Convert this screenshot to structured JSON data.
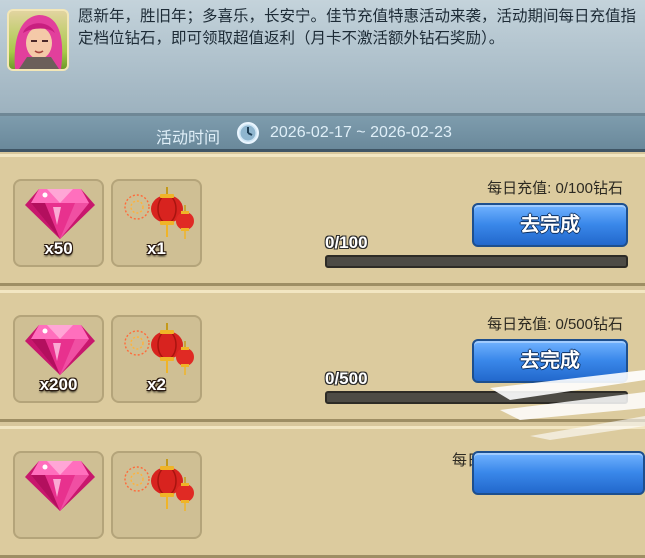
{
  "header": {
    "avatar_icon": "hero-avatar-icon",
    "intro_text": "愿新年，胜旧年；多喜乐，长安宁。佳节充值特惠活动来袭，活动期间每日充值指定档位钻石，即可领取超值返利（月卡不激活额外钻石奖励）。"
  },
  "event_time": {
    "label": "活动时间",
    "icon": "clock-icon",
    "range": "2026-02-17 ~ 2026-02-23"
  },
  "tasks": [
    {
      "requirement": "每日充值: 0/100钻石",
      "button_label": "去完成",
      "progress_text": "0/100",
      "progress_fraction": 0,
      "rewards": [
        {
          "icon": "pink-diamond-icon",
          "quantity": "x50"
        },
        {
          "icon": "firecracker-lantern-icon",
          "quantity": "x1"
        }
      ]
    },
    {
      "requirement": "每日充值: 0/500钻石",
      "button_label": "去完成",
      "progress_text": "0/500",
      "progress_fraction": 0,
      "rewards": [
        {
          "icon": "pink-diamond-icon",
          "quantity": "x200"
        },
        {
          "icon": "firecracker-lantern-icon",
          "quantity": "x2"
        }
      ]
    },
    {
      "requirement": "每日",
      "rewards": [
        {
          "icon": "pink-diamond-icon"
        },
        {
          "icon": "firecracker-lantern-icon"
        }
      ]
    }
  ],
  "colors": {
    "header_bg": "#b3c6d1",
    "timebar_bg": "#7592a4",
    "row_bg": "#dccb9e",
    "button_blue": "#3a88ea",
    "diamond_pink": "#e8318e",
    "lantern_red": "#d8231f"
  }
}
